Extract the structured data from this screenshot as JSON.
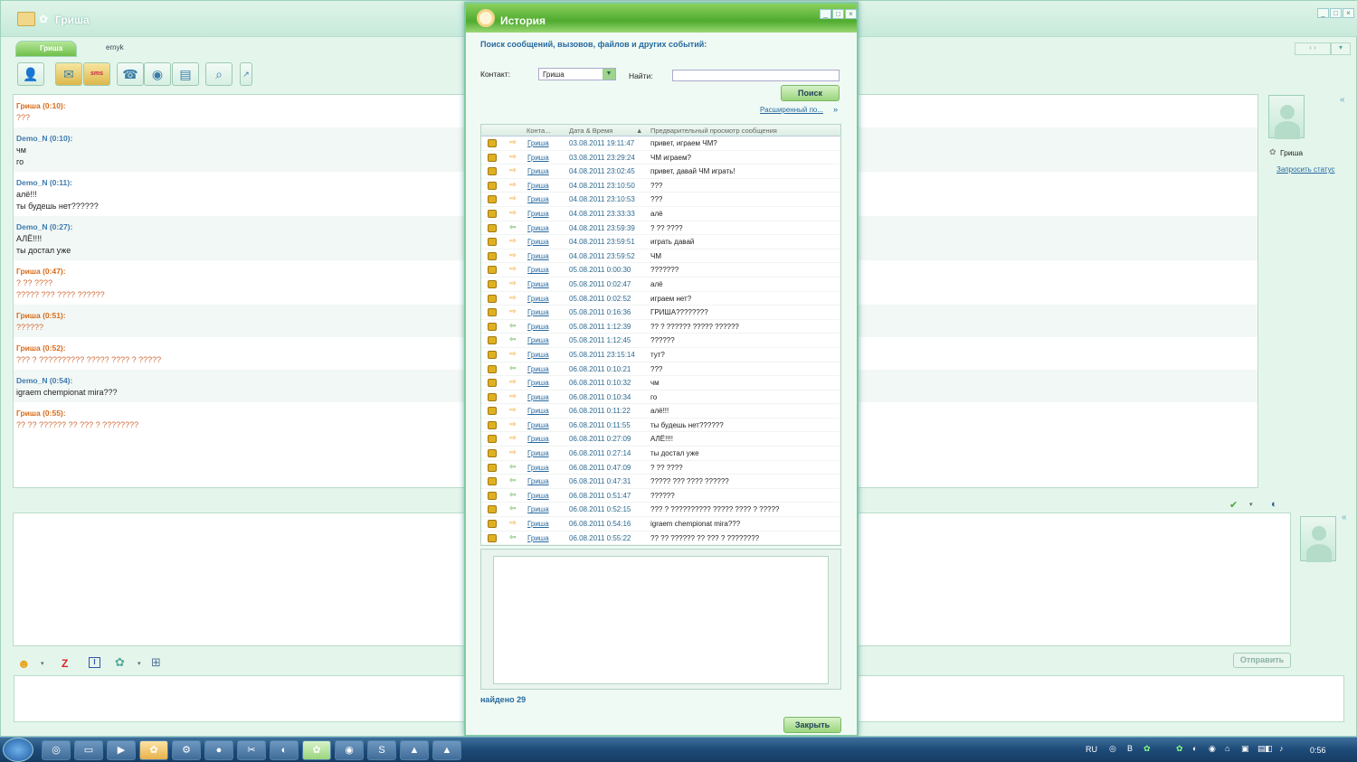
{
  "chat": {
    "title": "Гриша",
    "tabs": [
      "Гриша",
      "ernyk"
    ],
    "messages": [
      {
        "header": "Гриша (0:10):",
        "who": "g",
        "lines": [
          "???"
        ]
      },
      {
        "header": "Demo_N (0:10):",
        "who": "d",
        "lines": [
          "чм",
          "го"
        ]
      },
      {
        "header": "Demo_N (0:11):",
        "who": "d",
        "lines": [
          "алё!!!",
          "ты будешь нет??????"
        ]
      },
      {
        "header": "Demo_N (0:27):",
        "who": "d",
        "lines": [
          "АЛЁ!!!!",
          "ты достал уже"
        ]
      },
      {
        "header": "Гриша (0:47):",
        "who": "g",
        "lines": [
          "? ?? ????",
          "????? ??? ???? ??????"
        ]
      },
      {
        "header": "Гриша (0:51):",
        "who": "g",
        "lines": [
          "??????"
        ]
      },
      {
        "header": "Гриша (0:52):",
        "who": "g",
        "lines": [
          "??? ? ?????????? ????? ???? ? ?????"
        ]
      },
      {
        "header": "Demo_N (0:54):",
        "who": "d",
        "lines": [
          "igraem chempionat mira???"
        ]
      },
      {
        "header": "Гриша (0:55):",
        "who": "g",
        "lines": [
          "?? ?? ?????? ?? ??? ? ????????"
        ]
      }
    ],
    "contact_name": "Гриша",
    "request_status": "Запросить статус",
    "send_button": "Отправить",
    "toolbar_sms": "sms"
  },
  "history": {
    "title": "История",
    "heading": "Поиск сообщений, вызовов, файлов и других событий:",
    "contact_label": "Контакт:",
    "contact_value": "Гриша",
    "find_label": "Найти:",
    "find_value": "",
    "search_button": "Поиск",
    "advanced_link": "Расширенный по...",
    "columns": [
      "Конта...",
      "Дата & Время",
      "Предварительный просмотр сообщения"
    ],
    "rows": [
      {
        "dir": "out",
        "name": "Гриша",
        "date": "03.08.2011 19:11:47",
        "text": "привет, играем ЧМ?"
      },
      {
        "dir": "out",
        "name": "Гриша",
        "date": "03.08.2011 23:29:24",
        "text": "ЧМ играем?"
      },
      {
        "dir": "out",
        "name": "Гриша",
        "date": "04.08.2011 23:02:45",
        "text": "привет, давай ЧМ играть!"
      },
      {
        "dir": "out",
        "name": "Гриша",
        "date": "04.08.2011 23:10:50",
        "text": "???"
      },
      {
        "dir": "out",
        "name": "Гриша",
        "date": "04.08.2011 23:10:53",
        "text": "???"
      },
      {
        "dir": "out",
        "name": "Гриша",
        "date": "04.08.2011 23:33:33",
        "text": "алё"
      },
      {
        "dir": "in",
        "name": "Гриша",
        "date": "04.08.2011 23:59:39",
        "text": "? ?? ????"
      },
      {
        "dir": "out",
        "name": "Гриша",
        "date": "04.08.2011 23:59:51",
        "text": "играть давай"
      },
      {
        "dir": "out",
        "name": "Гриша",
        "date": "04.08.2011 23:59:52",
        "text": "ЧМ"
      },
      {
        "dir": "out",
        "name": "Гриша",
        "date": "05.08.2011 0:00:30",
        "text": "???????"
      },
      {
        "dir": "out",
        "name": "Гриша",
        "date": "05.08.2011 0:02:47",
        "text": "алё"
      },
      {
        "dir": "out",
        "name": "Гриша",
        "date": "05.08.2011 0:02:52",
        "text": "играем нет?"
      },
      {
        "dir": "out",
        "name": "Гриша",
        "date": "05.08.2011 0:16:36",
        "text": "ГРИША????????"
      },
      {
        "dir": "in",
        "name": "Гриша",
        "date": "05.08.2011 1:12:39",
        "text": "?? ? ?????? ????? ??????"
      },
      {
        "dir": "in",
        "name": "Гриша",
        "date": "05.08.2011 1:12:45",
        "text": "??????"
      },
      {
        "dir": "out",
        "name": "Гриша",
        "date": "05.08.2011 23:15:14",
        "text": "тут?"
      },
      {
        "dir": "in",
        "name": "Гриша",
        "date": "06.08.2011 0:10:21",
        "text": "???"
      },
      {
        "dir": "out",
        "name": "Гриша",
        "date": "06.08.2011 0:10:32",
        "text": "чм"
      },
      {
        "dir": "out",
        "name": "Гриша",
        "date": "06.08.2011 0:10:34",
        "text": "го"
      },
      {
        "dir": "out",
        "name": "Гриша",
        "date": "06.08.2011 0:11:22",
        "text": "алё!!!"
      },
      {
        "dir": "out",
        "name": "Гриша",
        "date": "06.08.2011 0:11:55",
        "text": "ты будешь нет??????"
      },
      {
        "dir": "out",
        "name": "Гриша",
        "date": "06.08.2011 0:27:09",
        "text": "АЛЁ!!!!"
      },
      {
        "dir": "out",
        "name": "Гриша",
        "date": "06.08.2011 0:27:14",
        "text": "ты достал уже"
      },
      {
        "dir": "in",
        "name": "Гриша",
        "date": "06.08.2011 0:47:09",
        "text": "? ?? ????"
      },
      {
        "dir": "in",
        "name": "Гриша",
        "date": "06.08.2011 0:47:31",
        "text": "????? ??? ???? ??????"
      },
      {
        "dir": "in",
        "name": "Гриша",
        "date": "06.08.2011 0:51:47",
        "text": "??????"
      },
      {
        "dir": "in",
        "name": "Гриша",
        "date": "06.08.2011 0:52:15",
        "text": "??? ? ?????????? ????? ???? ? ?????"
      },
      {
        "dir": "out",
        "name": "Гриша",
        "date": "06.08.2011 0:54:16",
        "text": "igraem chempionat mira???"
      },
      {
        "dir": "in",
        "name": "Гриша",
        "date": "06.08.2011 0:55:22",
        "text": "?? ?? ?????? ?? ??? ? ????????"
      }
    ],
    "found": "найдено 29",
    "close_button": "Закрыть"
  },
  "taskbar": {
    "lang": "RU",
    "clock": "0:56"
  }
}
